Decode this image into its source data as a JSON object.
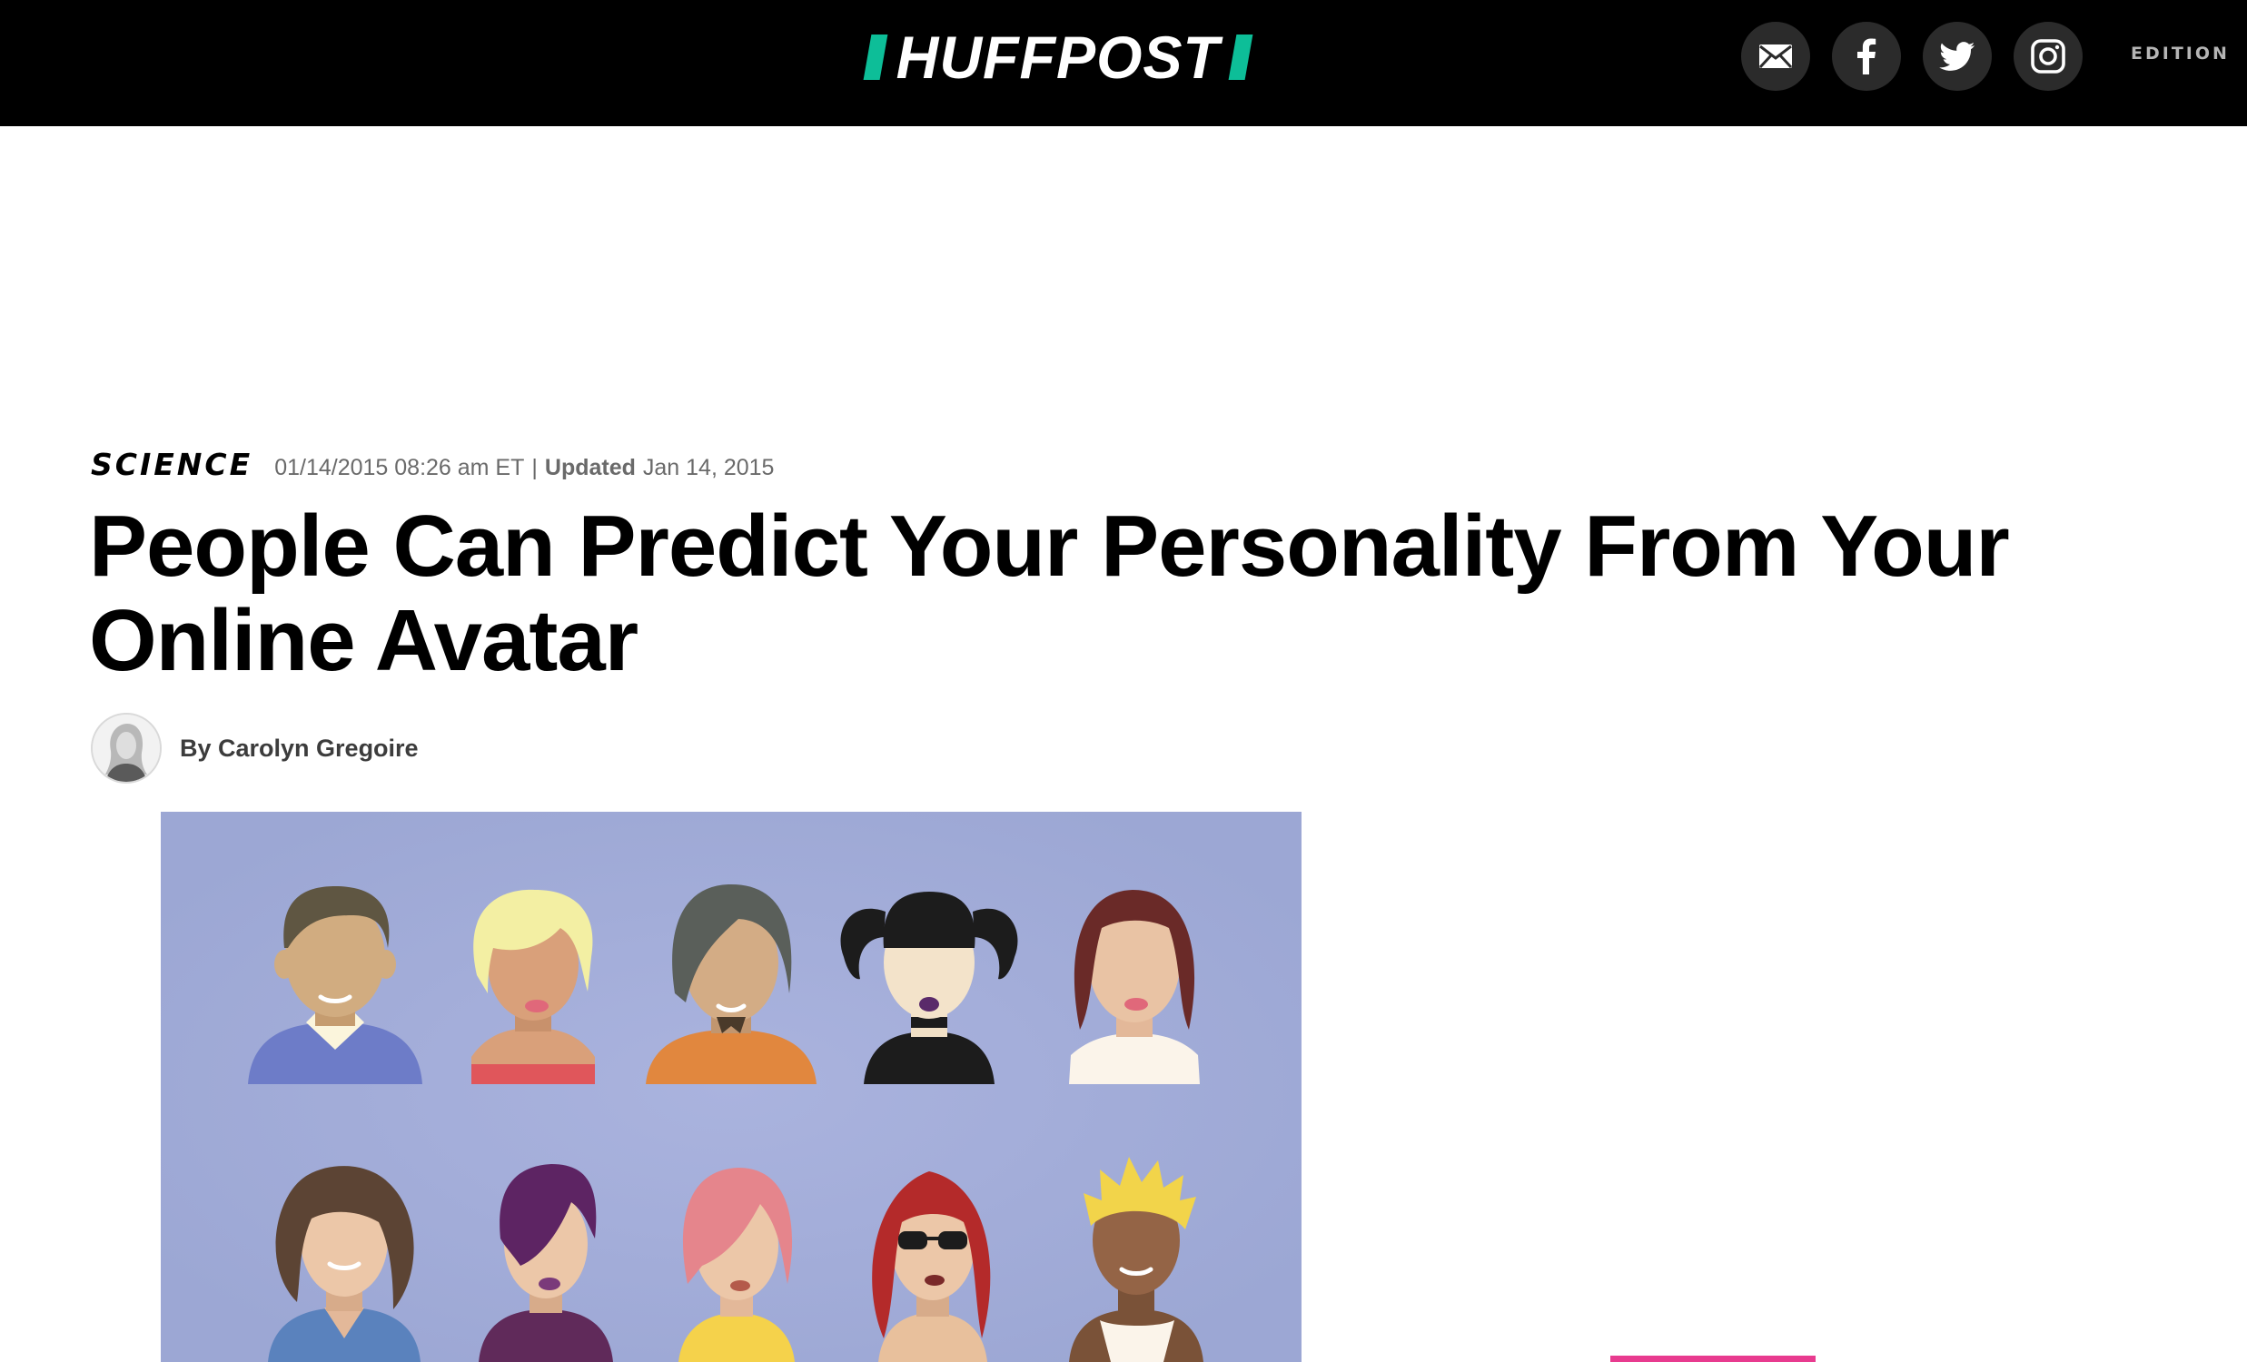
{
  "header": {
    "logo_text": "HUFFPOST",
    "edition_label": "EDITION",
    "social_icons": [
      "email-icon",
      "facebook-icon",
      "twitter-icon",
      "instagram-icon"
    ]
  },
  "article": {
    "section": "SCIENCE",
    "published": "01/14/2015 08:26 am ET",
    "separator": "|",
    "updated_label": "Updated",
    "updated_date": "Jan 14, 2015",
    "title": "People Can Predict Your Personality From Your Online Avatar",
    "byline": "By Carolyn Gregoire"
  },
  "colors": {
    "topbar": "#000000",
    "logo_accent": "#0dbe98",
    "hero_background": "#9ea9d6",
    "pink_accent": "#e83b8f"
  }
}
